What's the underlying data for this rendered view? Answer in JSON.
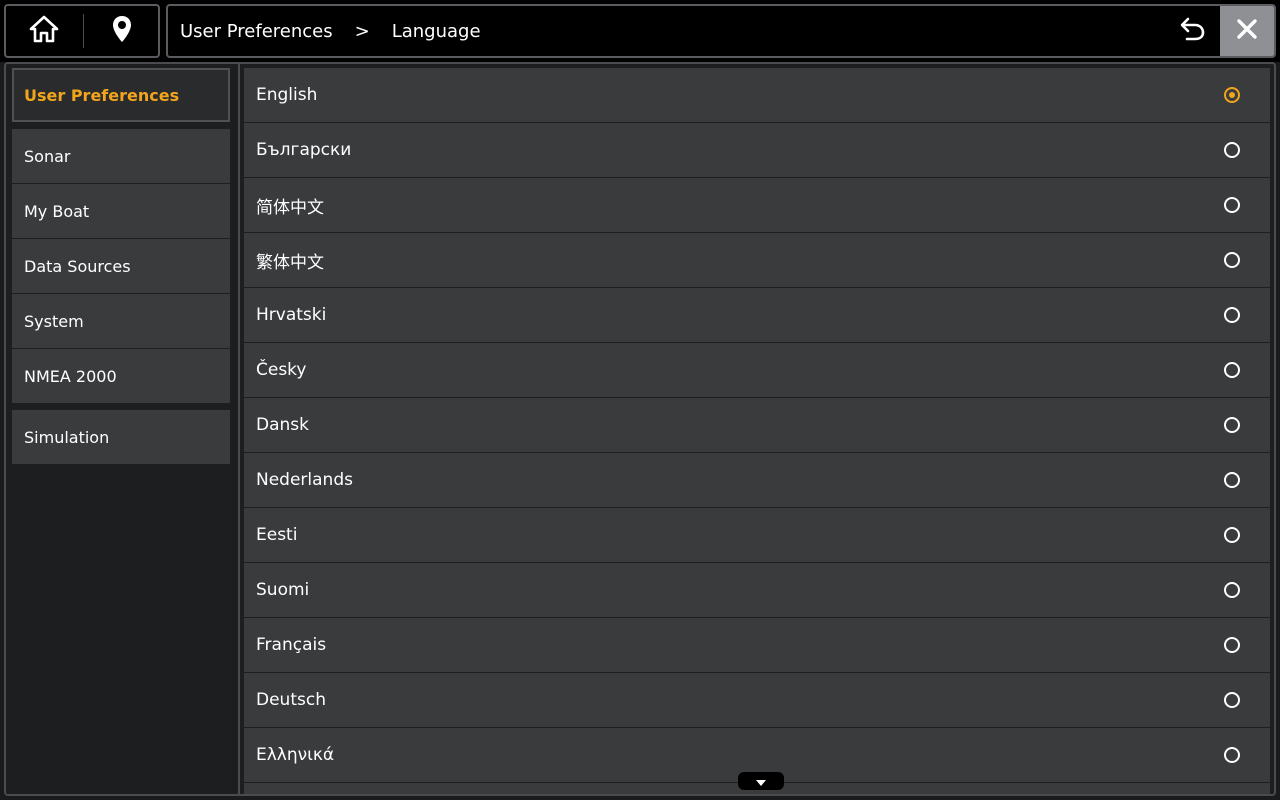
{
  "header": {
    "home_icon": "home-icon",
    "location_icon": "map-pin-icon",
    "breadcrumb": [
      "User Preferences",
      "Language"
    ],
    "breadcrumb_separator": ">",
    "back_icon": "undo-icon",
    "close_icon": "close-icon"
  },
  "sidebar": {
    "items": [
      {
        "label": "User Preferences",
        "active": true
      },
      {
        "label": "Sonar"
      },
      {
        "label": "My Boat"
      },
      {
        "label": "Data Sources"
      },
      {
        "label": "System"
      },
      {
        "label": "NMEA 2000"
      },
      {
        "label": "Simulation"
      }
    ]
  },
  "languages": [
    {
      "label": "English",
      "selected": true
    },
    {
      "label": "Български"
    },
    {
      "label": "简体中文"
    },
    {
      "label": "繁体中文"
    },
    {
      "label": "Hrvatski"
    },
    {
      "label": "Česky"
    },
    {
      "label": "Dansk"
    },
    {
      "label": "Nederlands"
    },
    {
      "label": "Eesti"
    },
    {
      "label": "Suomi"
    },
    {
      "label": "Français"
    },
    {
      "label": "Deutsch"
    },
    {
      "label": "Ελληνικά"
    }
  ],
  "scroll_icon": "chevron-down-icon",
  "colors": {
    "accent": "#f2a51c",
    "row_bg": "#3a3b3d",
    "background": "#1d1e20",
    "close_bg": "#8e9093"
  }
}
